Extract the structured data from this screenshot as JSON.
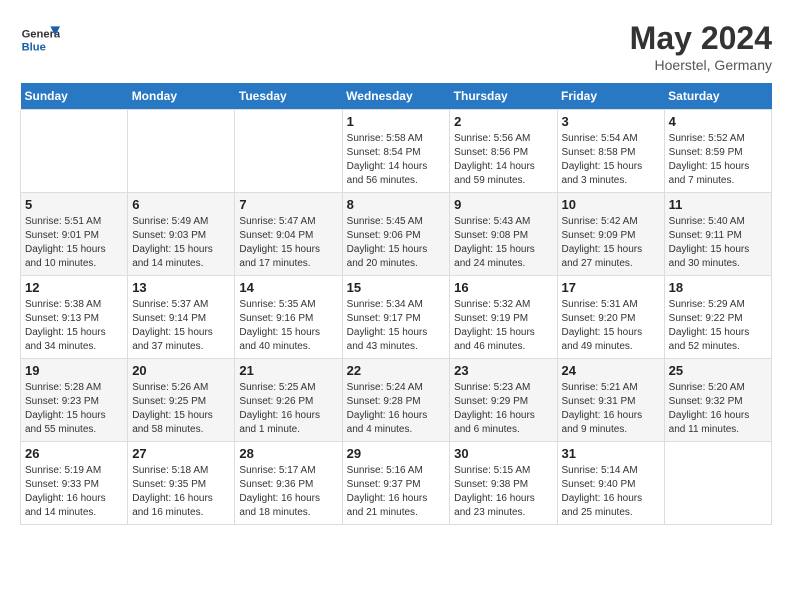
{
  "logo": {
    "line1": "General",
    "line2": "Blue"
  },
  "title": "May 2024",
  "subtitle": "Hoerstel, Germany",
  "days_of_week": [
    "Sunday",
    "Monday",
    "Tuesday",
    "Wednesday",
    "Thursday",
    "Friday",
    "Saturday"
  ],
  "weeks": [
    [
      {
        "day": "",
        "info": ""
      },
      {
        "day": "",
        "info": ""
      },
      {
        "day": "",
        "info": ""
      },
      {
        "day": "1",
        "info": "Sunrise: 5:58 AM\nSunset: 8:54 PM\nDaylight: 14 hours and 56 minutes."
      },
      {
        "day": "2",
        "info": "Sunrise: 5:56 AM\nSunset: 8:56 PM\nDaylight: 14 hours and 59 minutes."
      },
      {
        "day": "3",
        "info": "Sunrise: 5:54 AM\nSunset: 8:58 PM\nDaylight: 15 hours and 3 minutes."
      },
      {
        "day": "4",
        "info": "Sunrise: 5:52 AM\nSunset: 8:59 PM\nDaylight: 15 hours and 7 minutes."
      }
    ],
    [
      {
        "day": "5",
        "info": "Sunrise: 5:51 AM\nSunset: 9:01 PM\nDaylight: 15 hours and 10 minutes."
      },
      {
        "day": "6",
        "info": "Sunrise: 5:49 AM\nSunset: 9:03 PM\nDaylight: 15 hours and 14 minutes."
      },
      {
        "day": "7",
        "info": "Sunrise: 5:47 AM\nSunset: 9:04 PM\nDaylight: 15 hours and 17 minutes."
      },
      {
        "day": "8",
        "info": "Sunrise: 5:45 AM\nSunset: 9:06 PM\nDaylight: 15 hours and 20 minutes."
      },
      {
        "day": "9",
        "info": "Sunrise: 5:43 AM\nSunset: 9:08 PM\nDaylight: 15 hours and 24 minutes."
      },
      {
        "day": "10",
        "info": "Sunrise: 5:42 AM\nSunset: 9:09 PM\nDaylight: 15 hours and 27 minutes."
      },
      {
        "day": "11",
        "info": "Sunrise: 5:40 AM\nSunset: 9:11 PM\nDaylight: 15 hours and 30 minutes."
      }
    ],
    [
      {
        "day": "12",
        "info": "Sunrise: 5:38 AM\nSunset: 9:13 PM\nDaylight: 15 hours and 34 minutes."
      },
      {
        "day": "13",
        "info": "Sunrise: 5:37 AM\nSunset: 9:14 PM\nDaylight: 15 hours and 37 minutes."
      },
      {
        "day": "14",
        "info": "Sunrise: 5:35 AM\nSunset: 9:16 PM\nDaylight: 15 hours and 40 minutes."
      },
      {
        "day": "15",
        "info": "Sunrise: 5:34 AM\nSunset: 9:17 PM\nDaylight: 15 hours and 43 minutes."
      },
      {
        "day": "16",
        "info": "Sunrise: 5:32 AM\nSunset: 9:19 PM\nDaylight: 15 hours and 46 minutes."
      },
      {
        "day": "17",
        "info": "Sunrise: 5:31 AM\nSunset: 9:20 PM\nDaylight: 15 hours and 49 minutes."
      },
      {
        "day": "18",
        "info": "Sunrise: 5:29 AM\nSunset: 9:22 PM\nDaylight: 15 hours and 52 minutes."
      }
    ],
    [
      {
        "day": "19",
        "info": "Sunrise: 5:28 AM\nSunset: 9:23 PM\nDaylight: 15 hours and 55 minutes."
      },
      {
        "day": "20",
        "info": "Sunrise: 5:26 AM\nSunset: 9:25 PM\nDaylight: 15 hours and 58 minutes."
      },
      {
        "day": "21",
        "info": "Sunrise: 5:25 AM\nSunset: 9:26 PM\nDaylight: 16 hours and 1 minute."
      },
      {
        "day": "22",
        "info": "Sunrise: 5:24 AM\nSunset: 9:28 PM\nDaylight: 16 hours and 4 minutes."
      },
      {
        "day": "23",
        "info": "Sunrise: 5:23 AM\nSunset: 9:29 PM\nDaylight: 16 hours and 6 minutes."
      },
      {
        "day": "24",
        "info": "Sunrise: 5:21 AM\nSunset: 9:31 PM\nDaylight: 16 hours and 9 minutes."
      },
      {
        "day": "25",
        "info": "Sunrise: 5:20 AM\nSunset: 9:32 PM\nDaylight: 16 hours and 11 minutes."
      }
    ],
    [
      {
        "day": "26",
        "info": "Sunrise: 5:19 AM\nSunset: 9:33 PM\nDaylight: 16 hours and 14 minutes."
      },
      {
        "day": "27",
        "info": "Sunrise: 5:18 AM\nSunset: 9:35 PM\nDaylight: 16 hours and 16 minutes."
      },
      {
        "day": "28",
        "info": "Sunrise: 5:17 AM\nSunset: 9:36 PM\nDaylight: 16 hours and 18 minutes."
      },
      {
        "day": "29",
        "info": "Sunrise: 5:16 AM\nSunset: 9:37 PM\nDaylight: 16 hours and 21 minutes."
      },
      {
        "day": "30",
        "info": "Sunrise: 5:15 AM\nSunset: 9:38 PM\nDaylight: 16 hours and 23 minutes."
      },
      {
        "day": "31",
        "info": "Sunrise: 5:14 AM\nSunset: 9:40 PM\nDaylight: 16 hours and 25 minutes."
      },
      {
        "day": "",
        "info": ""
      }
    ]
  ]
}
